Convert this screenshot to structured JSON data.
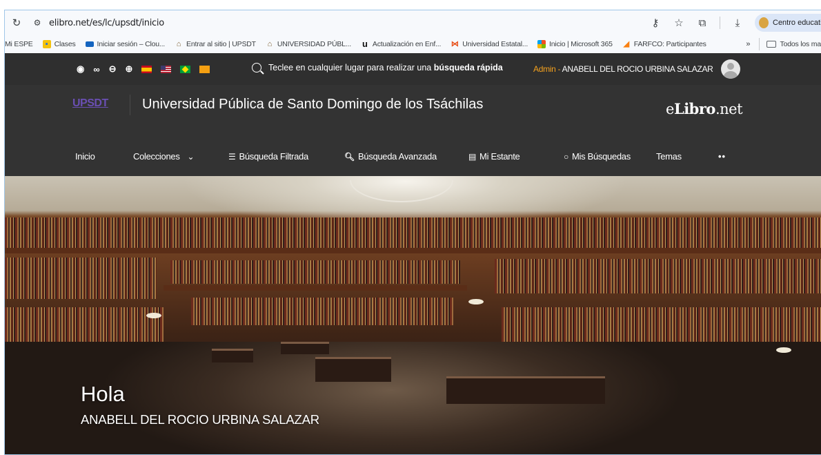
{
  "browser": {
    "url": "elibro.net/es/lc/upsdt/inicio",
    "profile_label": "Centro educativo",
    "icons": [
      "reload-icon",
      "site-info-icon",
      "password-key-icon",
      "star-icon",
      "extensions-icon",
      "download-icon"
    ]
  },
  "bookmarks": {
    "items": [
      {
        "label": "Mi ESPE",
        "icon": ""
      },
      {
        "label": "Clases",
        "icon": "classroom-icon"
      },
      {
        "label": "Iniciar sesión – Clou...",
        "icon": "cloud-icon"
      },
      {
        "label": "Entrar al sitio | UPSDT",
        "icon": "university-icon"
      },
      {
        "label": "UNIVERSIDAD PÚBL...",
        "icon": "university-icon"
      },
      {
        "label": "Actualización en Enf...",
        "icon": "u-logo-icon"
      },
      {
        "label": "Universidad Estatal...",
        "icon": "bowtie-icon"
      },
      {
        "label": "Inicio | Microsoft 365",
        "icon": "microsoft-icon"
      },
      {
        "label": "FARFCO: Participantes",
        "icon": "moodle-icon"
      }
    ],
    "more": "»",
    "all_bookmarks": "Todos los ma"
  },
  "topbar": {
    "quick_search_prefix": "Teclee en cualquier lugar para realizar una ",
    "quick_search_bold": "búsqueda rápida",
    "admin_role": "Admin",
    "admin_sep": " - ",
    "admin_name": "ANABELL DEL ROCIO URBINA SALAZAR"
  },
  "brand": {
    "logo": "UPSDT",
    "university": "Universidad Pública de Santo Domingo de los Tsáchilas",
    "elibro_e": "e",
    "elibro_bold": "Libro",
    "elibro_tail": ".net"
  },
  "nav": {
    "inicio": "Inicio",
    "colecciones": "Colecciones",
    "filtrada": "Búsqueda Filtrada",
    "avanzada": "Búsqueda Avanzada",
    "estante": "Mi Estante",
    "busquedas": "Mis Búsquedas",
    "temas": "Temas",
    "more": "••"
  },
  "hero": {
    "greeting": "Hola",
    "name": "ANABELL DEL ROCIO URBINA SALAZAR"
  },
  "colors": {
    "header_bg": "#333333",
    "accent_orange": "#f4a11e",
    "logo_purple": "#6a4fb3"
  }
}
